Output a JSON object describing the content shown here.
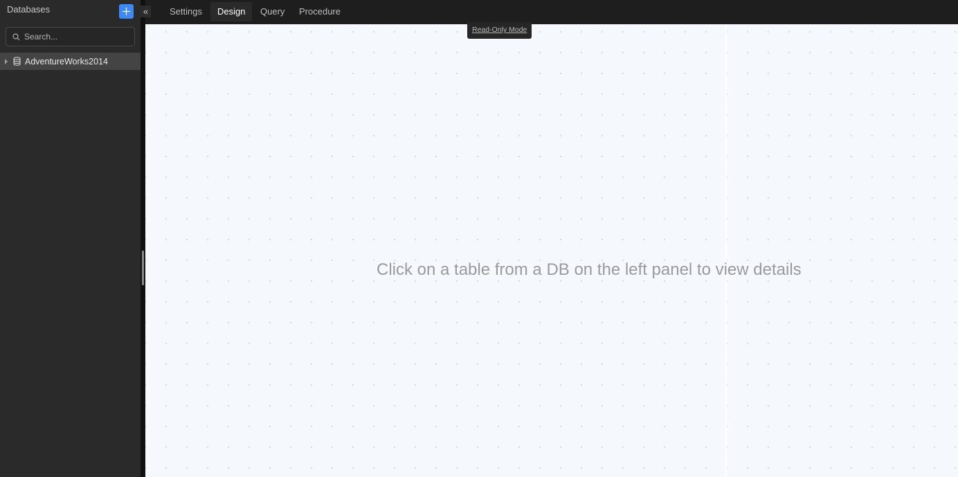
{
  "sidebar": {
    "title": "Databases",
    "add_button_icon": "plus-icon",
    "search": {
      "placeholder": "Search...",
      "value": ""
    },
    "tree": [
      {
        "label": "AdventureWorks2014",
        "icon": "database-icon",
        "expanded": false
      }
    ]
  },
  "collapse_icon": "double-chevron-left-icon",
  "tabs": [
    {
      "label": "Settings",
      "active": false
    },
    {
      "label": "Design",
      "active": true
    },
    {
      "label": "Query",
      "active": false
    },
    {
      "label": "Procedure",
      "active": false
    }
  ],
  "canvas": {
    "mode_badge": "Read-Only Mode",
    "empty_message": "Click on a table from a DB on the left panel to view details"
  },
  "colors": {
    "accent": "#3d8af7",
    "sidebar_bg": "#2a2a2a",
    "canvas_bg": "#f5f9fd"
  }
}
